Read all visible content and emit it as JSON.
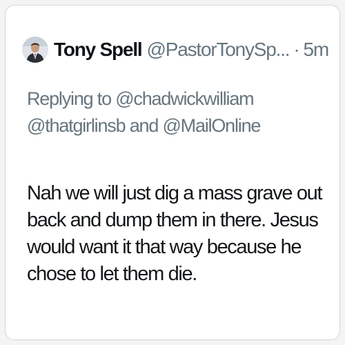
{
  "tweet": {
    "author": {
      "display_name": "Tony Spell",
      "handle": "@PastorTonySp...",
      "avatar_icon": "profile-photo"
    },
    "separator": "·",
    "timestamp": "5m",
    "reply": {
      "prefix": "Replying to",
      "mention_1": "@chadwickwilliam",
      "mention_2": "@thatgirlinsb",
      "conjunction": "and",
      "mention_3": "@MailOnline"
    },
    "text": "Nah we will just dig a mass grave out back and dump them in there. Jesus would want it that way because he chose to let them die."
  },
  "colors": {
    "name": "#0f1419",
    "secondary": "#66757f",
    "body_text": "#14171a",
    "card_background": "#ffffff",
    "border": "#d6d6d6"
  }
}
